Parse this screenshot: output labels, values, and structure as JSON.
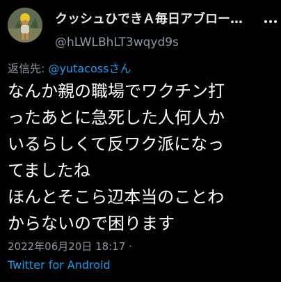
{
  "tweet": {
    "author": {
      "display_name": "クッシュひできＡ毎日アブロー…",
      "handle": "@hLWLBhLT3wqyd9s"
    },
    "reply": {
      "prefix": "返信先: ",
      "user": "@yutacoss",
      "suffix": "さん"
    },
    "text_lines": [
      "なんか親の職場でワクチン打",
      "ったあとに急死した人何人か",
      "いるらしくて反ワク派になっ",
      "てましたね",
      "ほんとそこら辺本当のことわ",
      "からないので困ります"
    ],
    "timestamp": "2022年06月20日 18:17 ·",
    "client": "Twitter for Android"
  },
  "icons": {
    "avatar": "avatar-photo",
    "more": "more-dots-icon"
  },
  "colors": {
    "background": "#000000",
    "text": "#ffffff",
    "secondary": "#8b98a5",
    "accent": "#1d9bf0"
  }
}
